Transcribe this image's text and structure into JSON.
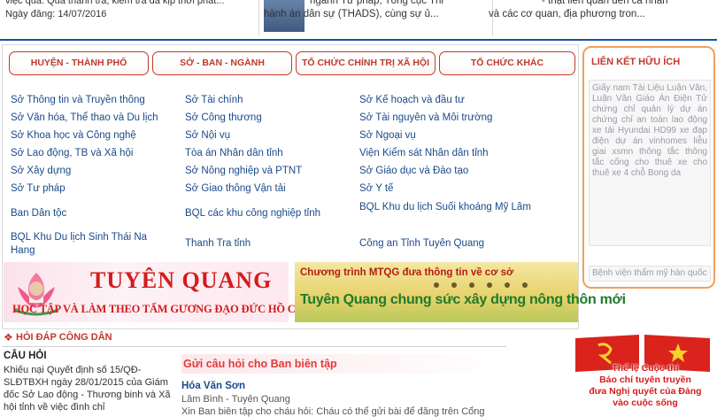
{
  "top_news": {
    "col1_line1": "việc qua. Qua thanh tra, kiểm tra đã kịp thời phát...",
    "col1_date": "Ngày đăng: 14/07/2016",
    "col2_line1": "ngành Tư pháp, Tổng cục Thi",
    "col2_line2": "hành án dân sự (THADS), cùng sự ủ...",
    "col3_line1": "- thật liên quan đến cá nhân",
    "col3_line2": "và các cơ quan, địa phương tron..."
  },
  "tabs": [
    "HUYỆN - THÀNH PHỐ",
    "SỞ - BAN - NGÀNH",
    "TỔ CHỨC CHÍNH TRỊ XÃ HỘI",
    "TỔ CHỨC KHÁC"
  ],
  "departments": {
    "col1": [
      "Sở Thông tin và Truyền thông",
      "Sở Văn hóa, Thể thao và Du lịch",
      "Sở Khoa học và Công nghệ",
      "Sở Lao động, TB và Xã hội",
      "Sở Xây dựng",
      "Sở Tư pháp",
      "Ban Dân tộc",
      "BQL Khu Du lịch Sinh Thái Na Hang"
    ],
    "col2": [
      "Sở Tài chính",
      "Sở Công thương",
      "Sở Nội vụ",
      "Tòa án Nhân dân tỉnh",
      "Sở Nông nghiệp và PTNT",
      "Sở Giao thông Vận tải",
      "BQL các khu công nghiệp tỉnh",
      "Thanh Tra tỉnh"
    ],
    "col3": [
      "Sở Kế hoạch và đầu tư",
      "Sở Tài nguyên và Môi trường",
      "Sở Ngoại vụ",
      "Viện Kiểm sát Nhân dân tỉnh",
      "Sở Giáo dục và Đào tạo",
      "Sở Y tế",
      "BQL Khu du lịch Suối khoáng Mỹ Lâm",
      "Công an Tỉnh Tuyên Quang"
    ]
  },
  "banner_left": {
    "title": "TUYÊN QUANG",
    "subtitle": "HỌC TẬP VÀ LÀM THEO TẤM GƯƠNG ĐẠO ĐỨC HỒ CHÍ MINH"
  },
  "banner_right": {
    "line1": "Chương trình MTQG đưa thông tin về cơ sở",
    "line2": "Tuyên Quang chung sức xây dựng nông thôn mới"
  },
  "links_box": {
    "title": "LIÊN KẾT HỮU ÍCH",
    "marquee": "Giấy nam Tài Liệu Luận Văn, Luận Văn Giáo Án Điện Tử chứng chỉ quản lý dự án chứng chỉ an toàn lao động xe tải Hyundai HD99 xe đạp điện dự án vinhomes liễu giai xsmn thông tắc thông tắc cống cho thuê xe cho thuê xe 4 chỗ Bong da",
    "select": "Bệnh viện thẩm mỹ hàn quốc"
  },
  "qa": {
    "section_title": "HỎI ĐÁP CÔNG DÂN",
    "question_label": "CÂU HỎI",
    "question_text": "Khiếu nại Quyết định số 15/QĐ-SLĐTBXH ngày 28/01/2015 của Giám đốc Sở Lao động - Thương binh và Xã hội tỉnh về việc đình chỉ",
    "ask_button": "Gửi câu hỏi cho Ban biên tập",
    "asker_name": "Hóa Văn Sơn",
    "asker_location": "Lâm Bình - Tuyên Quang",
    "asker_message": "Xin Ban biên tập cho cháu hỏi: Cháu có thể gửi bài để đăng trên Cổng"
  },
  "flag_banner": {
    "line1": "Thể lệ Cuộc thi",
    "line2": "Báo chí tuyên truyền",
    "line3": "đưa Nghị quyết của Đảng",
    "line4": "vào cuộc sống"
  },
  "colors": {
    "accent_red": "#c0392b",
    "link_blue": "#1a4a8a",
    "header_blue": "#1a4fa0",
    "box_orange": "#f0a060"
  }
}
